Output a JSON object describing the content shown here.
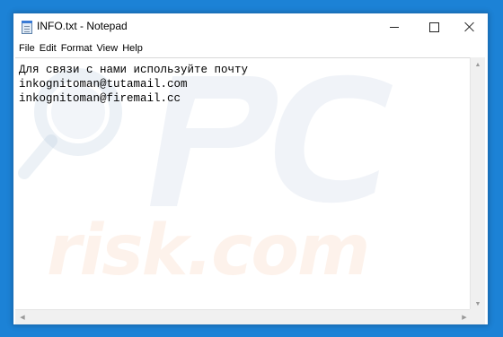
{
  "window": {
    "title": "INFO.txt - Notepad",
    "icon": "notepad-icon"
  },
  "controls": {
    "minimize_icon": "minimize-icon",
    "maximize_icon": "maximize-icon",
    "close_icon": "close-icon"
  },
  "menu": {
    "items": [
      "File",
      "Edit",
      "Format",
      "View",
      "Help"
    ]
  },
  "editor": {
    "lines": [
      "Для связи с нами используйте почту",
      "inkognitoman@tutamail.com",
      "inkognitoman@firemail.cc"
    ]
  },
  "watermark": {
    "text": "risk.com",
    "logo": "PC"
  },
  "colors": {
    "desktop": "#1c82d6",
    "window_border": "#1a6fb8"
  }
}
